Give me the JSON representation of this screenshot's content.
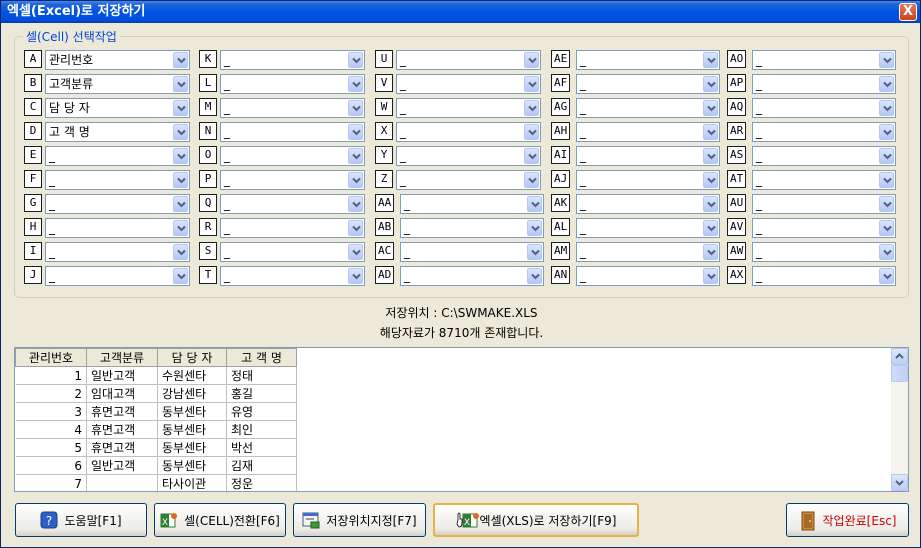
{
  "window": {
    "title": "엑셀(Excel)로 저장하기",
    "close_label": "X"
  },
  "group": {
    "caption": "셀(Cell) 선택작업"
  },
  "columns": [
    [
      {
        "letter": "A",
        "value": "관리번호"
      },
      {
        "letter": "B",
        "value": "고객분류"
      },
      {
        "letter": "C",
        "value": "담 당 자"
      },
      {
        "letter": "D",
        "value": "고 객 명"
      },
      {
        "letter": "E",
        "value": "_"
      },
      {
        "letter": "F",
        "value": "_"
      },
      {
        "letter": "G",
        "value": "_"
      },
      {
        "letter": "H",
        "value": "_"
      },
      {
        "letter": "I",
        "value": "_"
      },
      {
        "letter": "J",
        "value": "_"
      }
    ],
    [
      {
        "letter": "K",
        "value": "_"
      },
      {
        "letter": "L",
        "value": "_"
      },
      {
        "letter": "M",
        "value": "_"
      },
      {
        "letter": "N",
        "value": "_"
      },
      {
        "letter": "O",
        "value": "_"
      },
      {
        "letter": "P",
        "value": "_"
      },
      {
        "letter": "Q",
        "value": "_"
      },
      {
        "letter": "R",
        "value": "_"
      },
      {
        "letter": "S",
        "value": "_"
      },
      {
        "letter": "T",
        "value": "_"
      }
    ],
    [
      {
        "letter": "U",
        "value": "_"
      },
      {
        "letter": "V",
        "value": "_"
      },
      {
        "letter": "W",
        "value": "_"
      },
      {
        "letter": "X",
        "value": "_"
      },
      {
        "letter": "Y",
        "value": "_"
      },
      {
        "letter": "Z",
        "value": "_"
      },
      {
        "letter": "AA",
        "value": "_"
      },
      {
        "letter": "AB",
        "value": "_"
      },
      {
        "letter": "AC",
        "value": "_"
      },
      {
        "letter": "AD",
        "value": "_"
      }
    ],
    [
      {
        "letter": "AE",
        "value": "_"
      },
      {
        "letter": "AF",
        "value": "_"
      },
      {
        "letter": "AG",
        "value": "_"
      },
      {
        "letter": "AH",
        "value": "_"
      },
      {
        "letter": "AI",
        "value": "_"
      },
      {
        "letter": "AJ",
        "value": "_"
      },
      {
        "letter": "AK",
        "value": "_"
      },
      {
        "letter": "AL",
        "value": "_"
      },
      {
        "letter": "AM",
        "value": "_"
      },
      {
        "letter": "AN",
        "value": "_"
      }
    ],
    [
      {
        "letter": "AO",
        "value": "_"
      },
      {
        "letter": "AP",
        "value": "_"
      },
      {
        "letter": "AQ",
        "value": "_"
      },
      {
        "letter": "AR",
        "value": "_"
      },
      {
        "letter": "AS",
        "value": "_"
      },
      {
        "letter": "AT",
        "value": "_"
      },
      {
        "letter": "AU",
        "value": "_"
      },
      {
        "letter": "AV",
        "value": "_"
      },
      {
        "letter": "AW",
        "value": "_"
      },
      {
        "letter": "AX",
        "value": "_"
      }
    ]
  ],
  "info": {
    "save_path": "저장위치 : C:\\SWMAKE.XLS",
    "record_count": "해당자료가 8710개 존재합니다."
  },
  "grid": {
    "headers": [
      "관리번호",
      "고객분류",
      "담 당 자",
      "고 객 명"
    ],
    "rows": [
      [
        "1",
        "일반고객",
        "수원센타",
        "정태"
      ],
      [
        "2",
        "임대고객",
        "강남센타",
        "홍길"
      ],
      [
        "3",
        "휴면고객",
        "동부센타",
        "유영"
      ],
      [
        "4",
        "휴면고객",
        "동부센타",
        "최인"
      ],
      [
        "5",
        "휴면고객",
        "동부센타",
        "박선"
      ],
      [
        "6",
        "일반고객",
        "동부센타",
        "김재"
      ],
      [
        "7",
        "",
        "타사이관",
        "정운"
      ]
    ]
  },
  "buttons": {
    "help": "도움말[F1]",
    "cell_switch": "셀(CELL)전환[F6]",
    "save_location": "저장위치지정[F7]",
    "save_excel": "엑셀(XLS)로 저장하기[F9]",
    "finish": "작업완료[Esc]"
  },
  "colors": {
    "title_bar": "#0054e3",
    "group_caption": "#0046d5",
    "finish_text": "#cc0000"
  }
}
